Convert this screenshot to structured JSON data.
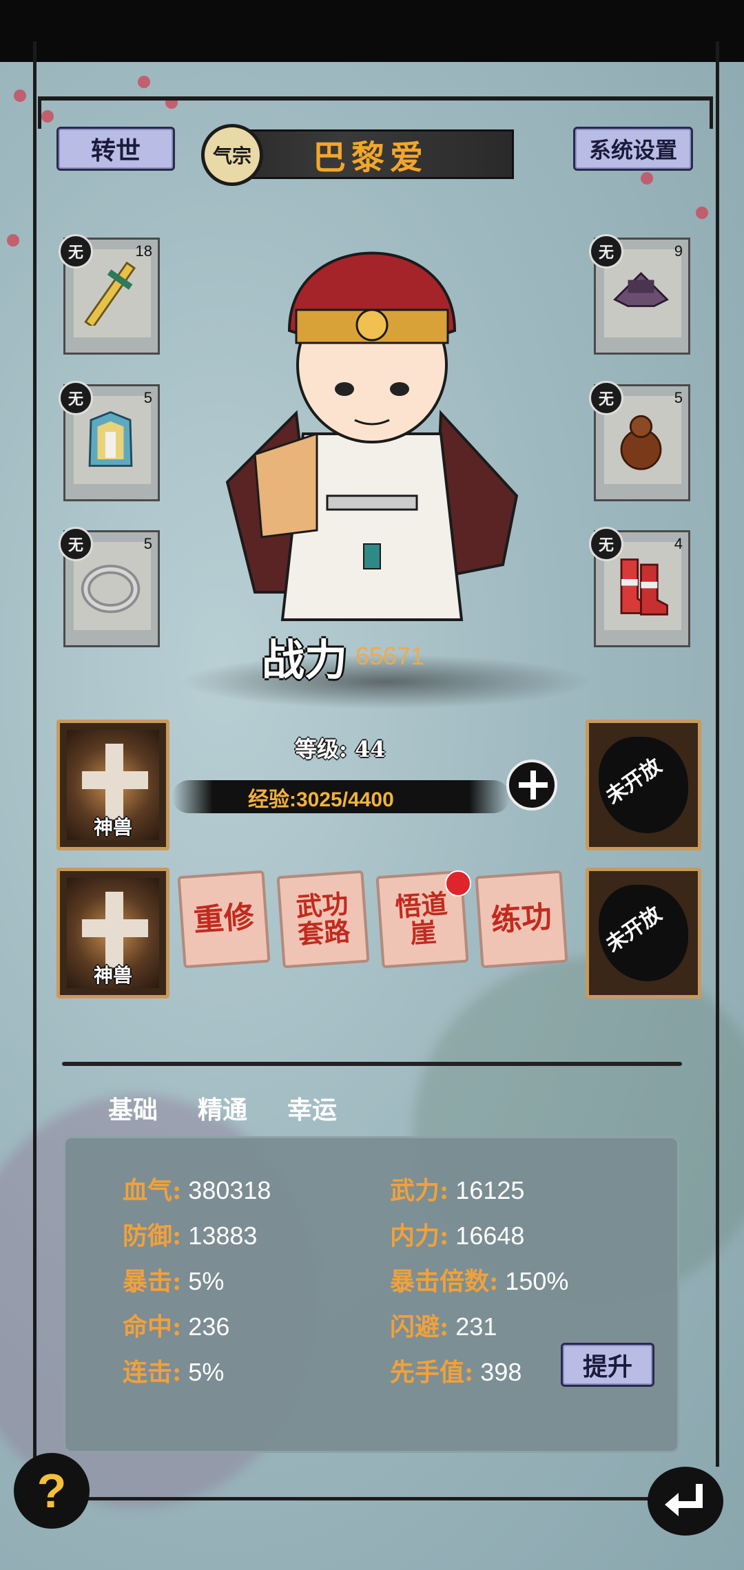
{
  "header": {
    "rebirth_label": "转世",
    "sect_badge": "气宗",
    "player_name": "巴黎爱",
    "settings_label": "系统设置"
  },
  "equipment": {
    "left": [
      {
        "badge": "无",
        "level": "18",
        "icon": "sword-icon"
      },
      {
        "badge": "无",
        "level": "5",
        "icon": "armor-icon"
      },
      {
        "badge": "无",
        "level": "5",
        "icon": "ring-icon"
      }
    ],
    "right": [
      {
        "badge": "无",
        "level": "9",
        "icon": "hat-icon"
      },
      {
        "badge": "无",
        "level": "5",
        "icon": "gourd-icon"
      },
      {
        "badge": "无",
        "level": "4",
        "icon": "boots-icon"
      }
    ]
  },
  "power": {
    "label": "战力",
    "value": "65671"
  },
  "level": {
    "text": "等级: 44"
  },
  "exp": {
    "text": "经验:3025/4400"
  },
  "beasts": [
    {
      "label": "神兽"
    },
    {
      "label": "神兽"
    }
  ],
  "locked_slots": [
    {
      "label": "未开放"
    },
    {
      "label": "未开放"
    }
  ],
  "functions": [
    {
      "label": "重修",
      "has_dot": false
    },
    {
      "label": "武功套路",
      "has_dot": false
    },
    {
      "label": "悟道崖",
      "has_dot": true
    },
    {
      "label": "练功",
      "has_dot": false
    }
  ],
  "tabs": [
    {
      "label": "基础",
      "active": true
    },
    {
      "label": "精通",
      "active": false
    },
    {
      "label": "幸运",
      "active": false
    }
  ],
  "stats": {
    "left": [
      {
        "key": "血气:",
        "value": "380318"
      },
      {
        "key": "防御:",
        "value": "13883"
      },
      {
        "key": "暴击:",
        "value": "5%"
      },
      {
        "key": "命中:",
        "value": "236"
      },
      {
        "key": "连击:",
        "value": "5%"
      }
    ],
    "right": [
      {
        "key": "武力:",
        "value": "16125"
      },
      {
        "key": "内力:",
        "value": "16648"
      },
      {
        "key": "暴击倍数:",
        "value": "150%"
      },
      {
        "key": "闪避:",
        "value": "231"
      },
      {
        "key": "先手值:",
        "value": "398"
      }
    ]
  },
  "upgrade_label": "提升",
  "help_label": "?",
  "colors": {
    "accent_orange": "#f2a13a",
    "button_lavender": "#b9bde6",
    "active_tab": "#c02a2a"
  }
}
